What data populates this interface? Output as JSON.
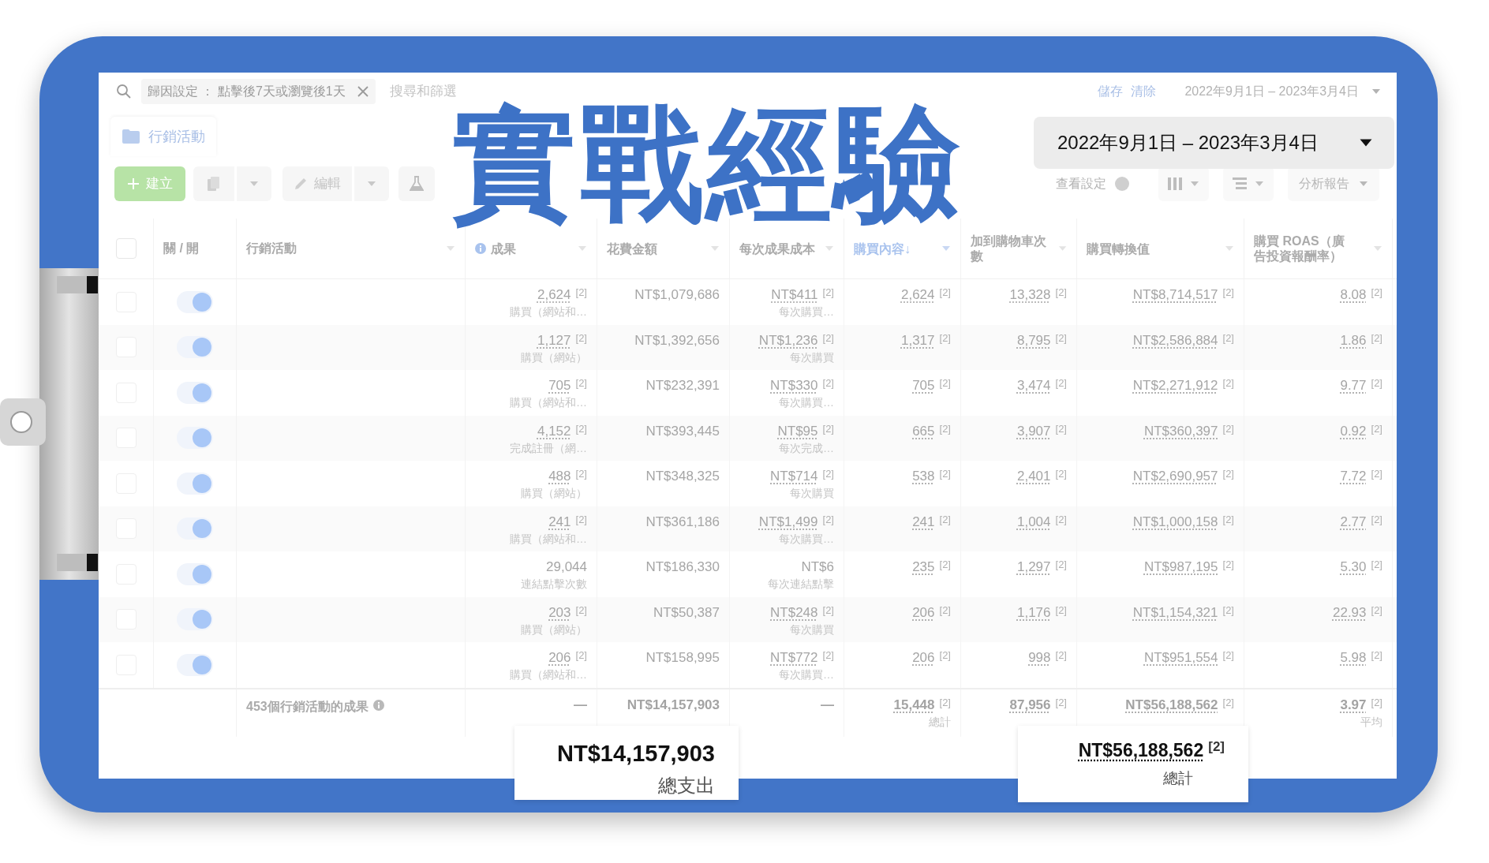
{
  "search_bar": {
    "filter_chip": "歸因設定 ： 點擊後7天或瀏覽後1天",
    "placeholder": "搜尋和篩選",
    "links": [
      "儲存",
      "清除"
    ],
    "date_range": "2022年9月1日 – 2023年3月4日"
  },
  "tabs": [
    {
      "label": "行銷活動",
      "selected": true
    }
  ],
  "toolbar": {
    "create": "建立",
    "edit": "編輯",
    "view_settings": "查看設定",
    "view_settings_on": false,
    "reports": "分析報告"
  },
  "overlay_title": "實戰經驗",
  "date_popup": "2022年9月1日 – 2023年3月4日",
  "table": {
    "all_checked": false,
    "toggle_header": "關 / 開",
    "name_header": "行銷活動",
    "columns": [
      {
        "label": "成果",
        "sorted": false,
        "info": true
      },
      {
        "label": "花費金額",
        "sorted": false,
        "info": false
      },
      {
        "label": "每次成果成本",
        "sorted": false,
        "info": false
      },
      {
        "label": "購買內容↓",
        "sorted": true,
        "info": false
      },
      {
        "label": "加到購物車次數",
        "sorted": false,
        "info": false
      },
      {
        "label": "購買轉換值",
        "sorted": false,
        "info": false
      },
      {
        "label": "購買 ROAS（廣告投資報酬率）",
        "sorted": false,
        "info": false
      }
    ],
    "rows": [
      {
        "checked": false,
        "on": true,
        "cells": [
          {
            "value": "2,624",
            "ref": "[2]",
            "sub": "購買（網站和…"
          },
          {
            "value": "NT$1,079,686"
          },
          {
            "value": "NT$411",
            "ref": "[2]",
            "sub": "每次購買…"
          },
          {
            "value": "2,624",
            "ref": "[2]"
          },
          {
            "value": "13,328",
            "ref": "[2]"
          },
          {
            "value": "NT$8,714,517",
            "ref": "[2]"
          },
          {
            "value": "8.08",
            "ref": "[2]"
          }
        ]
      },
      {
        "checked": false,
        "on": true,
        "cells": [
          {
            "value": "1,127",
            "ref": "[2]",
            "sub": "購買（網站）"
          },
          {
            "value": "NT$1,392,656"
          },
          {
            "value": "NT$1,236",
            "ref": "[2]",
            "sub": "每次購買"
          },
          {
            "value": "1,317",
            "ref": "[2]"
          },
          {
            "value": "8,795",
            "ref": "[2]"
          },
          {
            "value": "NT$2,586,884",
            "ref": "[2]"
          },
          {
            "value": "1.86",
            "ref": "[2]"
          }
        ]
      },
      {
        "checked": false,
        "on": true,
        "cells": [
          {
            "value": "705",
            "ref": "[2]",
            "sub": "購買（網站和…"
          },
          {
            "value": "NT$232,391"
          },
          {
            "value": "NT$330",
            "ref": "[2]",
            "sub": "每次購買…"
          },
          {
            "value": "705",
            "ref": "[2]"
          },
          {
            "value": "3,474",
            "ref": "[2]"
          },
          {
            "value": "NT$2,271,912",
            "ref": "[2]"
          },
          {
            "value": "9.77",
            "ref": "[2]"
          }
        ]
      },
      {
        "checked": false,
        "on": true,
        "cells": [
          {
            "value": "4,152",
            "ref": "[2]",
            "sub": "完成註冊（網…"
          },
          {
            "value": "NT$393,445"
          },
          {
            "value": "NT$95",
            "ref": "[2]",
            "sub": "每次完成…"
          },
          {
            "value": "665",
            "ref": "[2]"
          },
          {
            "value": "3,907",
            "ref": "[2]"
          },
          {
            "value": "NT$360,397",
            "ref": "[2]"
          },
          {
            "value": "0.92",
            "ref": "[2]"
          }
        ]
      },
      {
        "checked": false,
        "on": true,
        "cells": [
          {
            "value": "488",
            "ref": "[2]",
            "sub": "購買（網站）"
          },
          {
            "value": "NT$348,325"
          },
          {
            "value": "NT$714",
            "ref": "[2]",
            "sub": "每次購買"
          },
          {
            "value": "538",
            "ref": "[2]"
          },
          {
            "value": "2,401",
            "ref": "[2]"
          },
          {
            "value": "NT$2,690,957",
            "ref": "[2]"
          },
          {
            "value": "7.72",
            "ref": "[2]"
          }
        ]
      },
      {
        "checked": false,
        "on": true,
        "cells": [
          {
            "value": "241",
            "ref": "[2]",
            "sub": "購買（網站和…"
          },
          {
            "value": "NT$361,186"
          },
          {
            "value": "NT$1,499",
            "ref": "[2]",
            "sub": "每次購買…"
          },
          {
            "value": "241",
            "ref": "[2]"
          },
          {
            "value": "1,004",
            "ref": "[2]"
          },
          {
            "value": "NT$1,000,158",
            "ref": "[2]"
          },
          {
            "value": "2.77",
            "ref": "[2]"
          }
        ]
      },
      {
        "checked": false,
        "on": true,
        "cells": [
          {
            "value": "29,044",
            "sub": "連結點擊次數"
          },
          {
            "value": "NT$186,330"
          },
          {
            "value": "NT$6",
            "sub": "每次連結點擊"
          },
          {
            "value": "235",
            "ref": "[2]"
          },
          {
            "value": "1,297",
            "ref": "[2]"
          },
          {
            "value": "NT$987,195",
            "ref": "[2]"
          },
          {
            "value": "5.30",
            "ref": "[2]"
          }
        ]
      },
      {
        "checked": false,
        "on": true,
        "cells": [
          {
            "value": "203",
            "ref": "[2]",
            "sub": "購買（網站）"
          },
          {
            "value": "NT$50,387"
          },
          {
            "value": "NT$248",
            "ref": "[2]",
            "sub": "每次購買"
          },
          {
            "value": "206",
            "ref": "[2]"
          },
          {
            "value": "1,176",
            "ref": "[2]"
          },
          {
            "value": "NT$1,154,321",
            "ref": "[2]"
          },
          {
            "value": "22.93",
            "ref": "[2]"
          }
        ]
      },
      {
        "checked": false,
        "on": true,
        "cells": [
          {
            "value": "206",
            "ref": "[2]",
            "sub": "購買（網站和…"
          },
          {
            "value": "NT$158,995"
          },
          {
            "value": "NT$772",
            "ref": "[2]",
            "sub": "每次購買…"
          },
          {
            "value": "206",
            "ref": "[2]"
          },
          {
            "value": "998",
            "ref": "[2]"
          },
          {
            "value": "NT$951,554",
            "ref": "[2]"
          },
          {
            "value": "5.98",
            "ref": "[2]"
          }
        ]
      }
    ],
    "summary": {
      "label": "453個行銷活動的成果",
      "cells": [
        {
          "value": "—"
        },
        {
          "value": "NT$14,157,903"
        },
        {
          "value": "—"
        },
        {
          "value": "15,448",
          "ref": "[2]",
          "sub": "總計"
        },
        {
          "value": "87,956",
          "ref": "[2]"
        },
        {
          "value": "NT$56,188,562",
          "ref": "[2]"
        },
        {
          "value": "3.97",
          "ref": "[2]",
          "sub": "平均"
        }
      ]
    }
  },
  "callouts": [
    {
      "value": "NT$14,157,903",
      "label": "總支出"
    },
    {
      "value": "NT$56,188,562",
      "ref": "[2]",
      "label": "總計"
    }
  ]
}
